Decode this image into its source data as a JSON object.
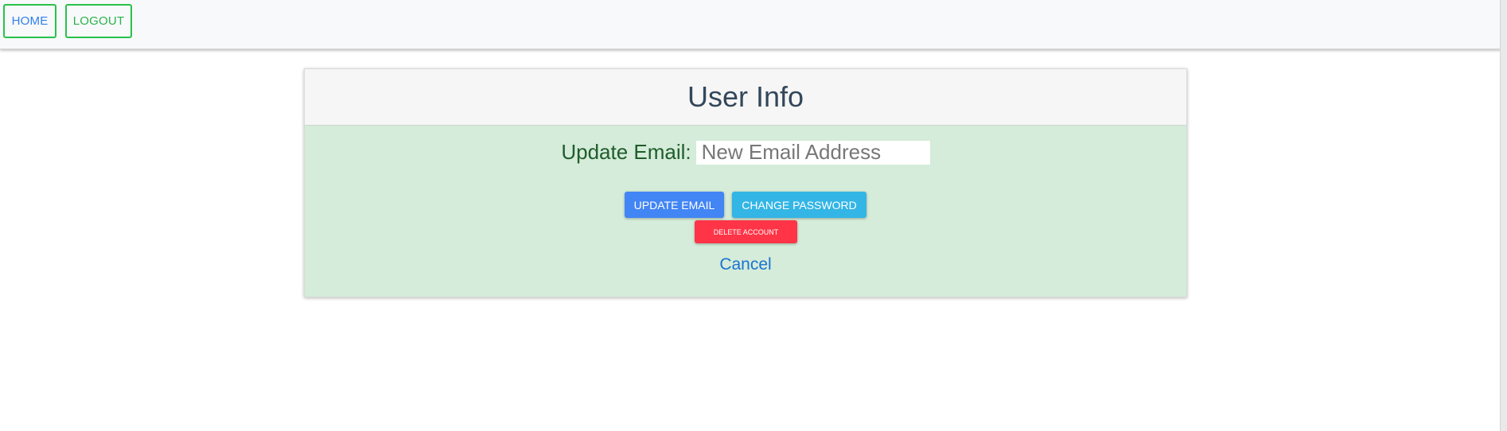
{
  "nav": {
    "home_label": "HOME",
    "logout_label": "LOGOUT"
  },
  "card": {
    "title": "User Info",
    "email_label": "Update Email:",
    "email_placeholder": "New Email Address",
    "email_value": "",
    "update_email_label": "UPDATE EMAIL",
    "change_password_label": "CHANGE PASSWORD",
    "delete_account_label": "DELETE ACCOUNT",
    "cancel_label": "Cancel"
  },
  "colors": {
    "nav_border": "#28c24a",
    "primary": "#4285f4",
    "info": "#33b5e5",
    "danger": "#ff3547",
    "card_bg": "#d4ecd9"
  }
}
